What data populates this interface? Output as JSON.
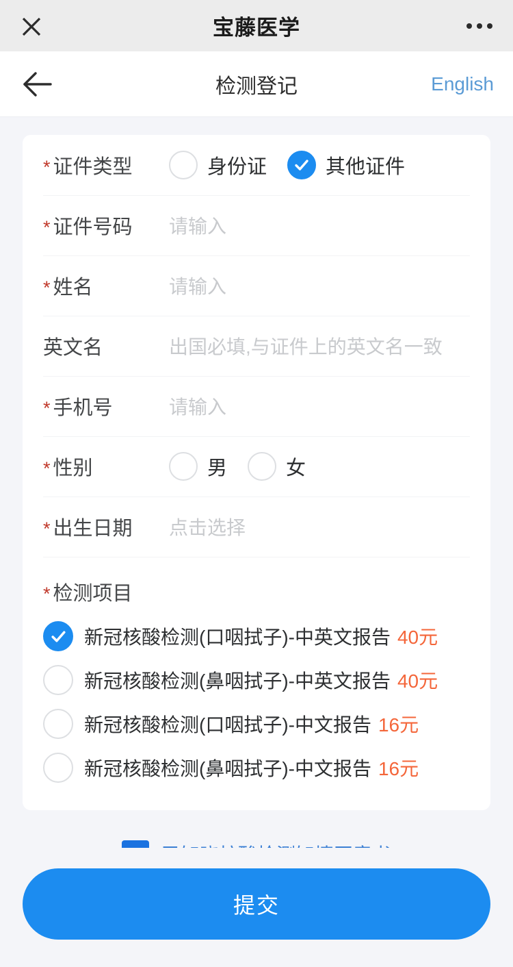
{
  "wechat_bar": {
    "close_icon": "close-icon",
    "title": "宝藤医学",
    "more_icon": "more-options-icon"
  },
  "nav": {
    "back_icon": "arrow-left-icon",
    "title": "检测登记",
    "language_link": "English"
  },
  "form": {
    "id_type": {
      "label": "证件类型",
      "required": "*",
      "options": [
        {
          "label": "身份证",
          "selected": false
        },
        {
          "label": "其他证件",
          "selected": true
        }
      ]
    },
    "id_number": {
      "label": "证件号码",
      "required": "*",
      "value": "",
      "placeholder": "请输入"
    },
    "name": {
      "label": "姓名",
      "required": "*",
      "value": "",
      "placeholder": "请输入"
    },
    "english_name": {
      "label": "英文名",
      "required": "",
      "value": "",
      "placeholder": "出国必填,与证件上的英文名一致"
    },
    "phone": {
      "label": "手机号",
      "required": "*",
      "value": "",
      "placeholder": "请输入"
    },
    "gender": {
      "label": "性别",
      "required": "*",
      "options": [
        {
          "label": "男",
          "selected": false
        },
        {
          "label": "女",
          "selected": false
        }
      ]
    },
    "birth_date": {
      "label": "出生日期",
      "required": "*",
      "value": "",
      "placeholder": "点击选择"
    },
    "test_items": {
      "label": "检测项目",
      "required": "*",
      "options": [
        {
          "name": "新冠核酸检测(口咽拭子)-中英文报告",
          "price": "40元",
          "selected": true
        },
        {
          "name": "新冠核酸检测(鼻咽拭子)-中英文报告",
          "price": "40元",
          "selected": false
        },
        {
          "name": "新冠核酸检测(口咽拭子)-中文报告",
          "price": "16元",
          "selected": false
        },
        {
          "name": "新冠核酸检测(鼻咽拭子)-中文报告",
          "price": "16元",
          "selected": false
        }
      ]
    }
  },
  "consent": {
    "checked": true,
    "link_text": "已知晓核酸检测知情同意书"
  },
  "footer": {
    "submit_label": "提交"
  },
  "colors": {
    "accent_blue": "#1c8cf0",
    "link_blue": "#5b9bd5",
    "consent_blue": "#1b72e0",
    "price_orange": "#f4663a",
    "required_red": "#c0392b",
    "page_bg": "#f4f5f9",
    "card_bg": "#ffffff",
    "wechat_bar_bg": "#ececec",
    "placeholder_gray": "#c8cacd",
    "label_gray": "#444648",
    "divider": "#f2f3f5"
  }
}
